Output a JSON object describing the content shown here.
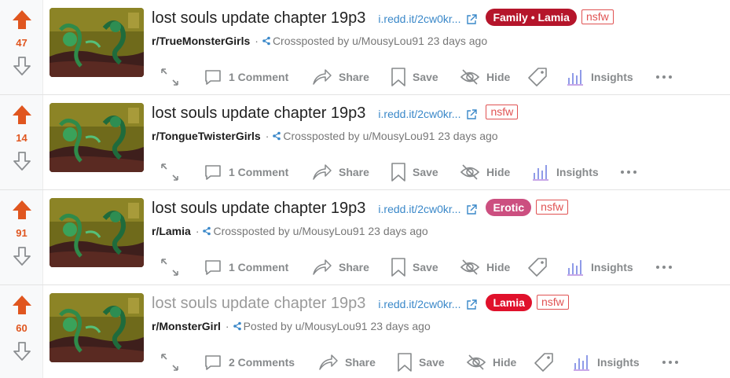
{
  "posts": [
    {
      "score": "47",
      "title": "lost souls update chapter 19p3",
      "domain": "i.redd.it/2cw0kr...",
      "flair": "Family • Lamia",
      "flair_color": "#b5152b",
      "nsfw": "nsfw",
      "subreddit": "r/TrueMonsterGirls",
      "post_type": "Crossposted by",
      "user": "u/MousyLou91",
      "age": "23 days ago",
      "comments": "1 Comment",
      "share": "Share",
      "save": "Save",
      "hide": "Hide",
      "insights": "Insights",
      "visited": false
    },
    {
      "score": "14",
      "title": "lost souls update chapter 19p3",
      "domain": "i.redd.it/2cw0kr...",
      "flair": "",
      "flair_color": "",
      "nsfw": "nsfw",
      "subreddit": "r/TongueTwisterGirls",
      "post_type": "Crossposted by",
      "user": "u/MousyLou91",
      "age": "23 days ago",
      "comments": "1 Comment",
      "share": "Share",
      "save": "Save",
      "hide": "Hide",
      "insights": "Insights",
      "visited": false
    },
    {
      "score": "91",
      "title": "lost souls update chapter 19p3",
      "domain": "i.redd.it/2cw0kr...",
      "flair": "Erotic",
      "flair_color": "#cc4f80",
      "nsfw": "nsfw",
      "subreddit": "r/Lamia",
      "post_type": "Crossposted by",
      "user": "u/MousyLou91",
      "age": "23 days ago",
      "comments": "1 Comment",
      "share": "Share",
      "save": "Save",
      "hide": "Hide",
      "insights": "Insights",
      "visited": false
    },
    {
      "score": "60",
      "title": "lost souls update chapter 19p3",
      "domain": "i.redd.it/2cw0kr...",
      "flair": "Lamia",
      "flair_color": "#e0112b",
      "nsfw": "nsfw",
      "subreddit": "r/MonsterGirl",
      "post_type": "Posted by",
      "user": "u/MousyLou91",
      "age": "23 days ago",
      "comments": "2 Comments",
      "share": "Share",
      "save": "Save",
      "hide": "Hide",
      "insights": "Insights",
      "visited": true
    }
  ],
  "colors": {
    "upvote": "#e0561f",
    "link": "#3a88c9",
    "nsfw": "#e05252",
    "action": "#878a8c"
  },
  "icons": [
    "upvote-arrow-icon",
    "downvote-arrow-icon",
    "external-link-icon",
    "crosspost-icon",
    "expand-icon",
    "comment-icon",
    "share-icon",
    "bookmark-icon",
    "hide-icon",
    "tag-icon",
    "insights-icon",
    "more-icon"
  ]
}
